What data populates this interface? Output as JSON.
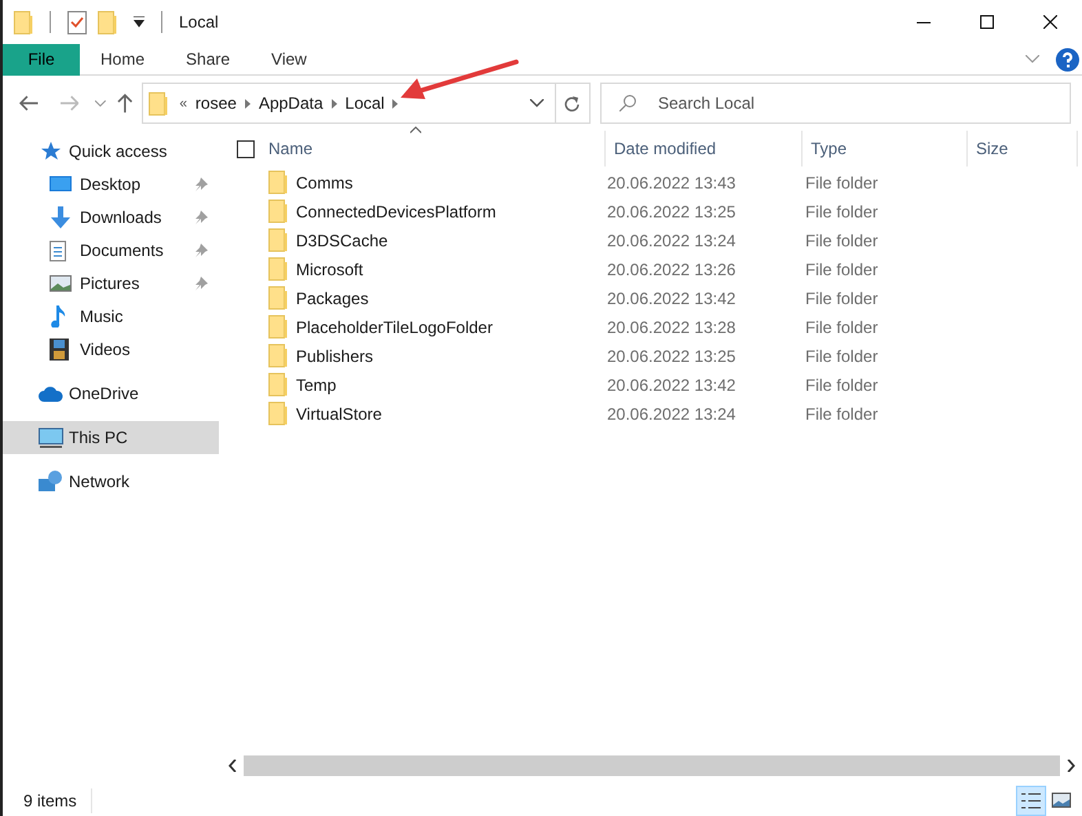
{
  "window": {
    "title": "Local"
  },
  "ribbon": {
    "tabs": [
      {
        "label": "File",
        "selected": true
      },
      {
        "label": "Home",
        "selected": false
      },
      {
        "label": "Share",
        "selected": false
      },
      {
        "label": "View",
        "selected": false
      }
    ]
  },
  "address": {
    "overflow": "«",
    "crumbs": [
      "rosee",
      "AppData",
      "Local"
    ]
  },
  "search": {
    "placeholder": "Search Local"
  },
  "sidebar": {
    "items": [
      {
        "label": "Quick access",
        "selected": false,
        "children": [
          {
            "label": "Desktop",
            "pinned": true,
            "selected": false
          },
          {
            "label": "Downloads",
            "pinned": true,
            "selected": false
          },
          {
            "label": "Documents",
            "pinned": true,
            "selected": false
          },
          {
            "label": "Pictures",
            "pinned": true,
            "selected": false
          },
          {
            "label": "Music",
            "pinned": false,
            "selected": false
          },
          {
            "label": "Videos",
            "pinned": false,
            "selected": false
          }
        ]
      },
      {
        "label": "OneDrive",
        "selected": false
      },
      {
        "label": "This PC",
        "selected": true
      },
      {
        "label": "Network",
        "selected": false
      }
    ]
  },
  "table": {
    "select_all": {
      "checked": false
    },
    "columns": [
      "Name",
      "Date modified",
      "Type",
      "Size"
    ],
    "rows": [
      {
        "name": "Comms",
        "date": "20.06.2022 13:43",
        "type": "File folder"
      },
      {
        "name": "ConnectedDevicesPlatform",
        "date": "20.06.2022 13:25",
        "type": "File folder"
      },
      {
        "name": "D3DSCache",
        "date": "20.06.2022 13:24",
        "type": "File folder"
      },
      {
        "name": "Microsoft",
        "date": "20.06.2022 13:26",
        "type": "File folder"
      },
      {
        "name": "Packages",
        "date": "20.06.2022 13:42",
        "type": "File folder"
      },
      {
        "name": "PlaceholderTileLogoFolder",
        "date": "20.06.2022 13:28",
        "type": "File folder"
      },
      {
        "name": "Publishers",
        "date": "20.06.2022 13:25",
        "type": "File folder"
      },
      {
        "name": "Temp",
        "date": "20.06.2022 13:42",
        "type": "File folder"
      },
      {
        "name": "VirtualStore",
        "date": "20.06.2022 13:24",
        "type": "File folder"
      }
    ]
  },
  "status_bar": {
    "count": "9 items",
    "views": [
      {
        "kind": "details",
        "selected": true
      },
      {
        "kind": "large",
        "selected": false
      }
    ]
  }
}
